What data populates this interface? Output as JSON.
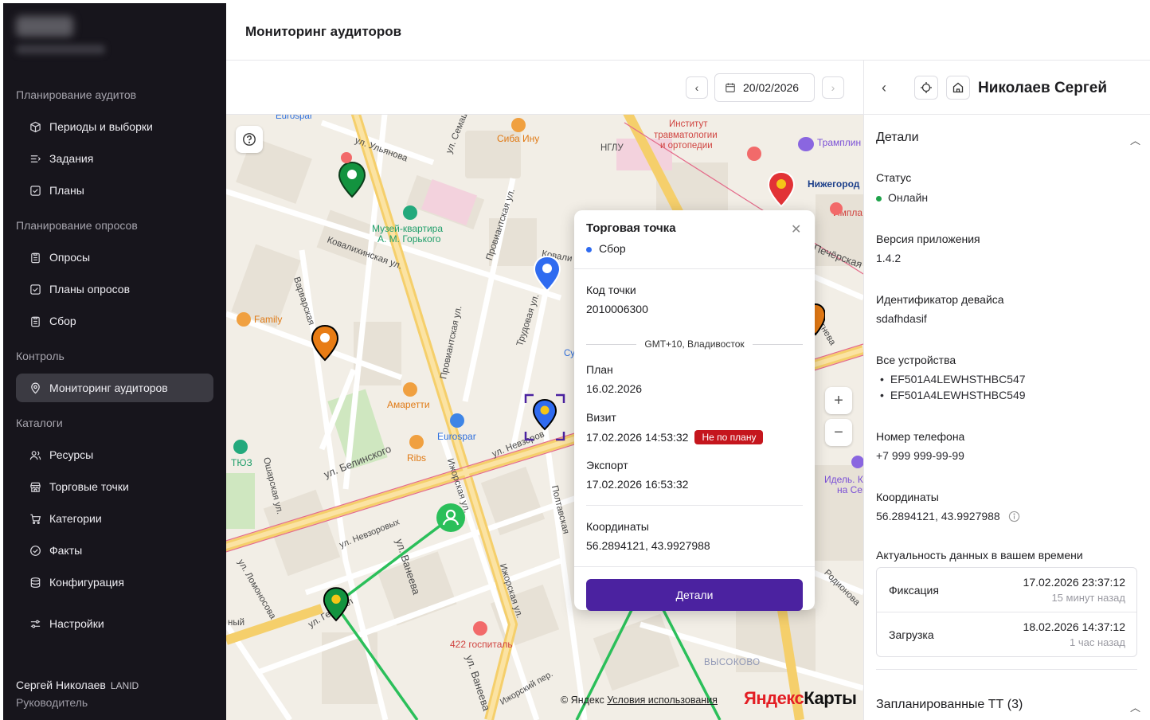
{
  "sidebar": {
    "sections": [
      "Планирование аудитов",
      "Планирование опросов",
      "Контроль",
      "Каталоги"
    ],
    "items": [
      {
        "label": "Периоды и выборки",
        "icon": "cube-icon"
      },
      {
        "label": "Задания",
        "icon": "list-icon"
      },
      {
        "label": "Планы",
        "icon": "checkbox-icon"
      },
      {
        "label": "Опросы",
        "icon": "clipboard-icon"
      },
      {
        "label": "Планы опросов",
        "icon": "checkbox-icon"
      },
      {
        "label": "Сбор",
        "icon": "clipboard-icon"
      },
      {
        "label": "Мониторинг аудиторов",
        "icon": "location-pin-icon",
        "active": true
      },
      {
        "label": "Ресурсы",
        "icon": "users-icon"
      },
      {
        "label": "Торговые точки",
        "icon": "store-icon"
      },
      {
        "label": "Категории",
        "icon": "cart-icon"
      },
      {
        "label": "Факты",
        "icon": "check-circle-icon"
      },
      {
        "label": "Конфигурация",
        "icon": "database-icon"
      },
      {
        "label": "Настройки",
        "icon": "sliders-icon"
      }
    ],
    "user": {
      "name": "Сергей Николаев",
      "org": "LANID",
      "role": "Руководитель"
    }
  },
  "header": {
    "title": "Мониторинг аудиторов"
  },
  "toolbar": {
    "date": "20/02/2026"
  },
  "map": {
    "labels": {
      "eurospar_top": "Eurospar",
      "ulyanova": "ул. Ульянова",
      "semashko": "ул. Семаш",
      "ngl": "НГЛУ",
      "siba": "Сиба Ину",
      "institute1": "Институт",
      "institute2": "травматологии",
      "institute3": "и ортопедии",
      "tramplin": "Трамплин",
      "nizhegorod": "Нижегород",
      "impla": "Импла",
      "museum1": "Музей-квартира",
      "museum2": "А. М. Горького",
      "kovalikh": "Ковалихинская ул.",
      "provianskaya": "Провиантская ул.",
      "kovali": "Ковали",
      "pechersk": "Печёрская",
      "varvarskaya": "Варварская",
      "family": "Family",
      "trudovaya": "Трудовая ул.",
      "provianskaya2": "Провиантская ул.",
      "amaretti": "Амаретти",
      "eurospar": "Eurospar",
      "ribs": "Ribs",
      "tyuz": "ТЮЗ",
      "belinskogo": "ул. Белинского",
      "nevzorov": "ул. Невзоров",
      "izhorskaya": "Ижорская ул.",
      "oshar": "Ошарская ул.",
      "nevzorovyh": "ул. Невзоровых",
      "vaneeva": "ул. Ванеева",
      "poltavskaya": "Полтавская",
      "gener": "ул. Генерал",
      "lomonosova": "ул. Ломоносова",
      "hospital": "422 госпиталь",
      "izhorskaya2": "Ижорская ул.",
      "vysokovo": "ВЫСОКОВО",
      "idel1": "Идель. К",
      "idel2": "на Сен",
      "rodionova": "Родионова",
      "streets_nyi": "ный",
      "izhorsky": "Ижорский пер.",
      "vaneeva2": "ул. Ванеева",
      "su": "Су",
      "genevy": "гнева"
    },
    "copyright": "© Яндекс",
    "terms": "Условия использования",
    "logo_a": "Яндекс",
    "logo_b": "Карты"
  },
  "popup": {
    "title": "Торговая точка",
    "status": "Сбор",
    "status_color": "#2f6bf0",
    "code_label": "Код точки",
    "code": "2010006300",
    "timezone": "GMT+10, Владивосток",
    "plan_label": "План",
    "plan": "16.02.2026",
    "visit_label": "Визит",
    "visit": "17.02.2026 14:53:32",
    "visit_badge": "Не по плану",
    "export_label": "Экспорт",
    "export": "17.02.2026 16:53:32",
    "coords_label": "Координаты",
    "coords": "56.2894121, 43.9927988",
    "button": "Детали"
  },
  "panel": {
    "name": "Николаев Сергей",
    "details_title": "Детали",
    "status_label": "Статус",
    "status": "Онлайн",
    "status_color": "#1fa34a",
    "version_label": "Версия приложения",
    "version": "1.4.2",
    "device_label": "Идентификатор девайса",
    "device": "sdafhdasif",
    "all_devices_label": "Все устройства",
    "devices": [
      "EF501A4LEWHSTHBC547",
      "EF501A4LEWHSTHBC549"
    ],
    "phone_label": "Номер телефона",
    "phone": "+7 999 999-99-99",
    "coords_label": "Координаты",
    "coords": "56.2894121, 43.9927988",
    "actuality_label": "Актуальность данных в вашем времени",
    "fix_label": "Фиксация",
    "fix_date": "17.02.2026 23:37:12",
    "fix_ago": "15 минут назад",
    "load_label": "Загрузка",
    "load_date": "18.02.2026 14:37:12",
    "load_ago": "1 час назад",
    "planned_title": "Запланированные ТТ (3)"
  }
}
